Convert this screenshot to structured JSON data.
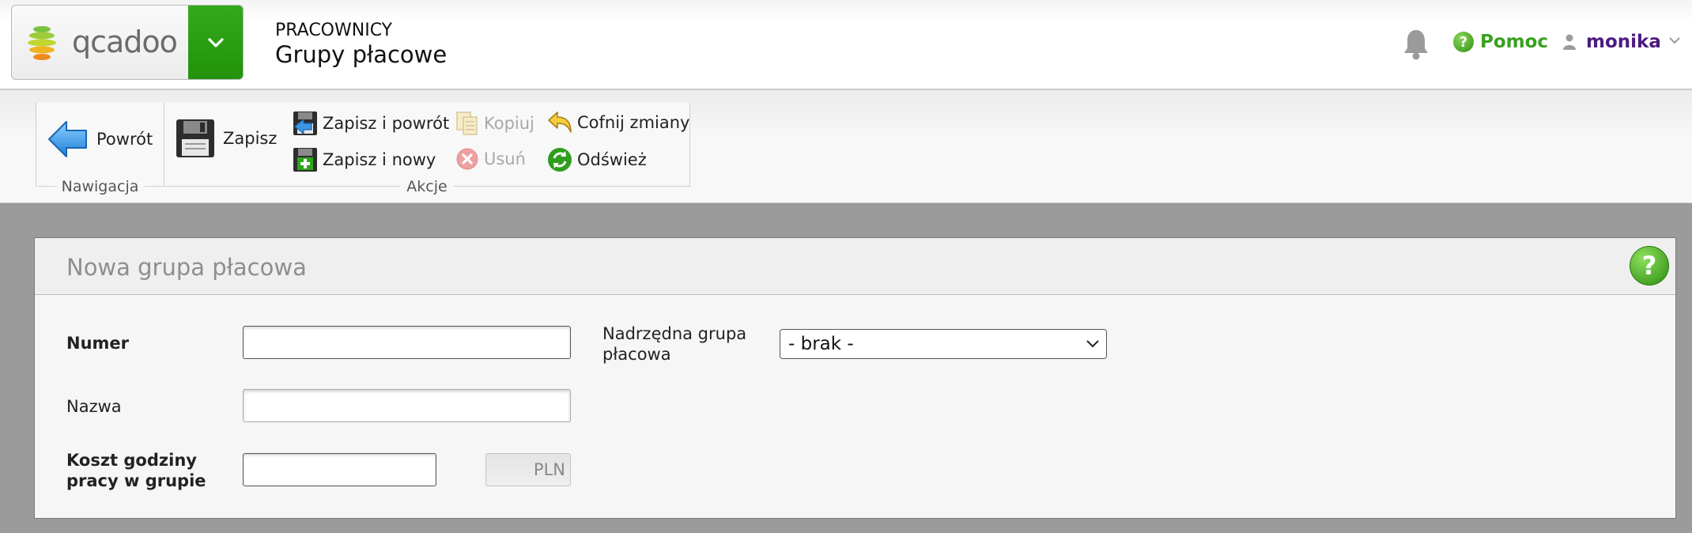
{
  "header": {
    "logo_text": "qcadoo",
    "section": "PRACOWNICY",
    "title": "Grupy płacowe",
    "help_label": "Pomoc",
    "user_name": "monika"
  },
  "toolbar": {
    "nav_group_label": "Nawigacja",
    "actions_group_label": "Akcje",
    "back": "Powrót",
    "save": "Zapisz",
    "save_and_back": "Zapisz i powrót",
    "save_and_new": "Zapisz i nowy",
    "copy": "Kopiuj",
    "delete": "Usuń",
    "undo": "Cofnij zmiany",
    "refresh": "Odśwież"
  },
  "form": {
    "title": "Nowa grupa płacowa",
    "number_label": "Numer",
    "number_value": "",
    "name_label": "Nazwa",
    "name_value": "",
    "cost_label_line1": "Koszt godziny",
    "cost_label_line2": "pracy w grupie",
    "cost_value": "",
    "currency": "PLN",
    "parent_label_line1": "Nadrzędna grupa",
    "parent_label_line2": "płacowa",
    "parent_value": "- brak -"
  },
  "colors": {
    "brand_green": "#2a9a12",
    "help_green": "#37a11e",
    "user_purple": "#4d1a7f",
    "page_bg": "#9b9b9b"
  }
}
